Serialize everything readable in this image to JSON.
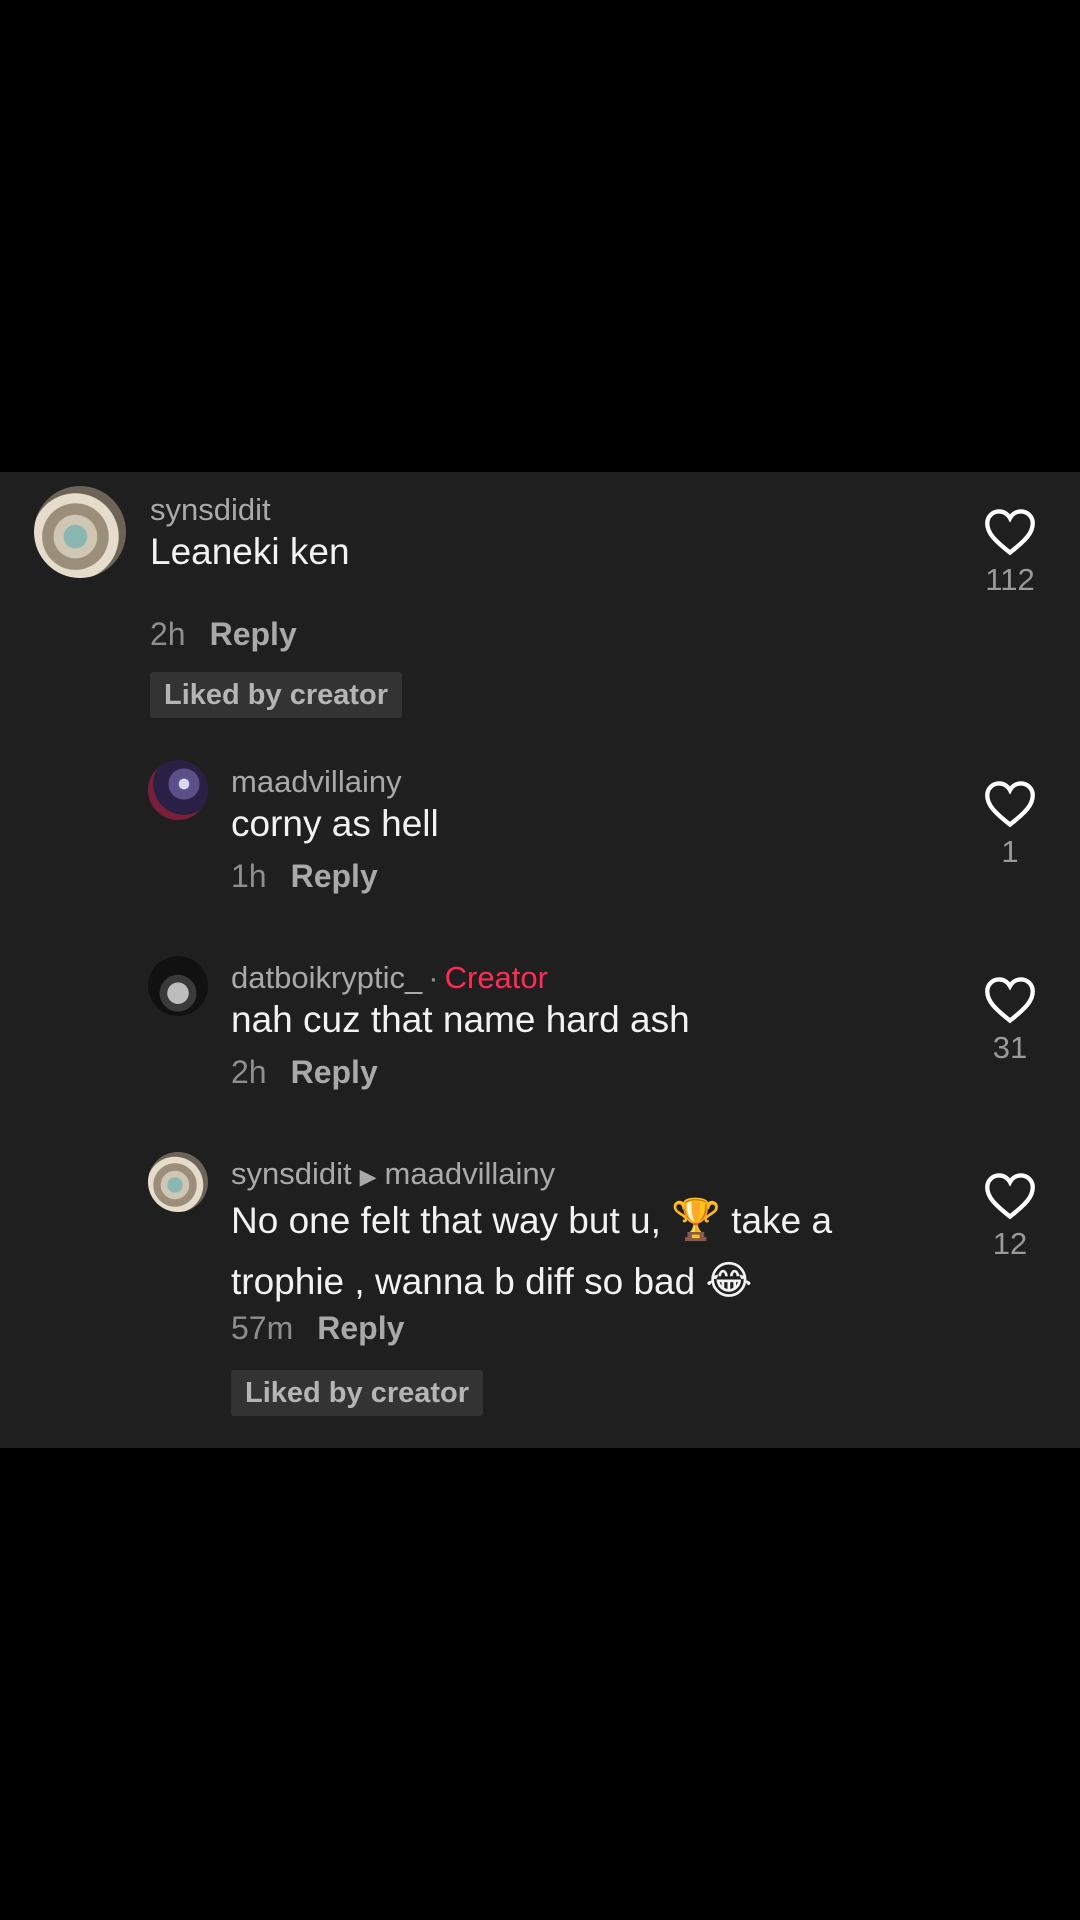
{
  "comments": [
    {
      "username": "synsdidit",
      "text": "Leaneki ken",
      "time": "2h",
      "reply_label": "Reply",
      "likes": "112",
      "liked_by_creator": "Liked by creator"
    },
    {
      "username": "maadvillainy",
      "text": "corny as hell",
      "time": "1h",
      "reply_label": "Reply",
      "likes": "1"
    },
    {
      "username": "datboikryptic_",
      "separator": "·",
      "creator_label": "Creator",
      "text": "nah cuz that name hard ash",
      "time": "2h",
      "reply_label": "Reply",
      "likes": "31"
    },
    {
      "username": "synsdidit",
      "reply_to": "maadvillainy",
      "text_line1_a": "No one felt that way but u,",
      "emoji_trophy": "🏆",
      "text_line1_b": "take a",
      "text_line2": "trophie , wanna b diff so bad",
      "emoji_laugh": "😂",
      "time": "57m",
      "reply_label": "Reply",
      "likes": "12",
      "liked_by_creator": "Liked by creator"
    }
  ],
  "colors": {
    "panel_bg": "#1f1f1f",
    "creator_accent": "#fe2c55",
    "username": "#a9a9a9",
    "body_text": "#f2f2f2"
  },
  "icons": {
    "like": "heart-outline-icon",
    "reply_arrow": "play-triangle-icon"
  }
}
